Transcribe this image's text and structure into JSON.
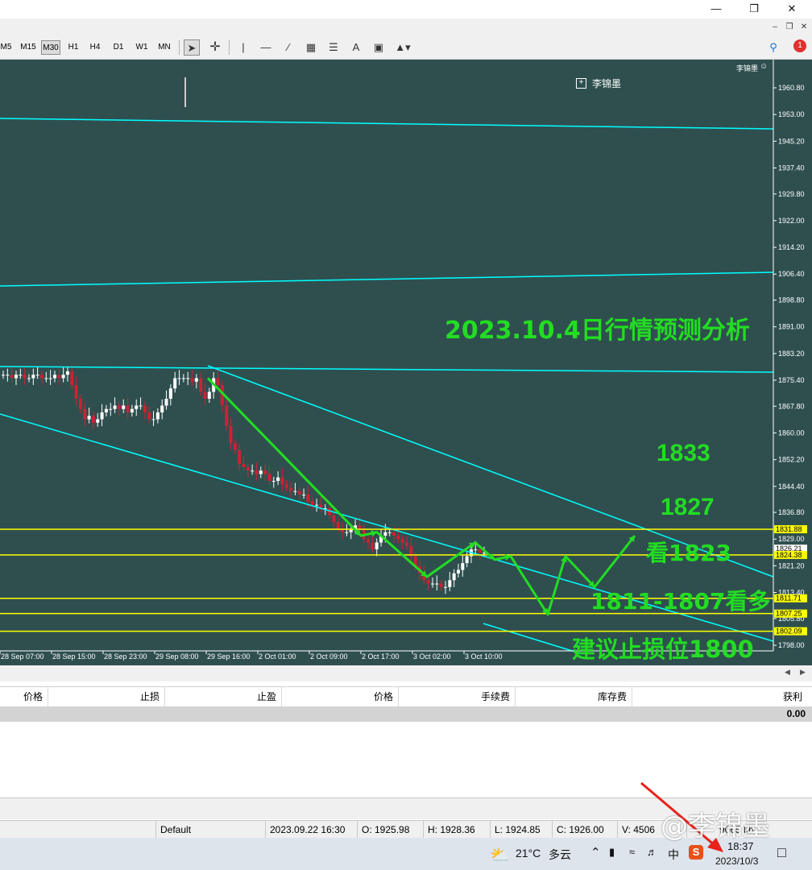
{
  "window": {
    "minimize_icon": "minimize-icon",
    "restore_icon": "restore-icon",
    "close_icon": "close-icon"
  },
  "toolbar": {
    "timeframes": [
      "M5",
      "M15",
      "M30",
      "H1",
      "H4",
      "D1",
      "W1",
      "MN"
    ],
    "active_timeframe": "M30",
    "tools": [
      "cursor-icon",
      "crosshair-icon",
      "vertical-line-icon",
      "horizontal-line-icon",
      "trendline-icon",
      "channel-icon",
      "fibonacci-icon",
      "text-icon",
      "text-label-icon",
      "shapes-icon"
    ],
    "search_icon": "search-icon",
    "notification_count": "1"
  },
  "chart": {
    "colors": {
      "background": "#2f4f4f",
      "line": "#00ffff",
      "level": "#ffff00",
      "arrow": "#22dd22",
      "annotation": "#22dd22",
      "bull": "#ffffff",
      "bear": "#cc2233",
      "axis_text": "#ffffff"
    },
    "top_right_label": "李锦墨",
    "object_label": "李锦墨",
    "annotation_title": "2023.10.4日行情预测分析",
    "annotations": [
      "1833",
      "1827",
      "看1823",
      "1811-1807看多",
      "建议止损位1800"
    ],
    "price_axis": [
      "1960.80",
      "1953.00",
      "1945.20",
      "1937.40",
      "1929.80",
      "1922.00",
      "1914.20",
      "1906.40",
      "1898.80",
      "1891.00",
      "1883.20",
      "1875.40",
      "1867.80",
      "1860.00",
      "1852.20",
      "1844.40",
      "1836.80",
      "1829.00",
      "1821.20",
      "1813.40",
      "1805.80",
      "1798.00"
    ],
    "price_labels": [
      "1831.88",
      "1826.21",
      "1824.38",
      "1811.71",
      "1807.25",
      "1802.09"
    ],
    "time_axis": [
      "28 Sep 07:00",
      "28 Sep 15:00",
      "28 Sep 23:00",
      "29 Sep 08:00",
      "29 Sep 16:00",
      "2 Oct 01:00",
      "2 Oct 09:00",
      "2 Oct 17:00",
      "3 Oct 02:00",
      "3 Oct 10:00"
    ]
  },
  "chart_data": {
    "type": "candlestick",
    "symbol_timeframe": "M30",
    "ylim": [
      1798.0,
      1964.0
    ],
    "x_ticks": [
      "28 Sep 07:00",
      "28 Sep 15:00",
      "28 Sep 23:00",
      "29 Sep 08:00",
      "29 Sep 16:00",
      "2 Oct 01:00",
      "2 Oct 09:00",
      "2 Oct 17:00",
      "3 Oct 02:00",
      "3 Oct 10:00"
    ],
    "y_ticks": [
      1960.8,
      1953.0,
      1945.2,
      1937.4,
      1929.8,
      1922.0,
      1914.2,
      1906.4,
      1898.8,
      1891.0,
      1883.2,
      1875.4,
      1867.8,
      1860.0,
      1852.2,
      1844.4,
      1836.8,
      1829.0,
      1821.2,
      1813.4,
      1805.8,
      1798.0
    ],
    "horizontal_levels": [
      1831.88,
      1824.38,
      1811.71,
      1807.25,
      1802.09
    ],
    "current_price": 1826.21,
    "close_series_approx": [
      1877,
      1877,
      1876,
      1877,
      1877,
      1876,
      1876,
      1877,
      1877,
      1876,
      1876,
      1876,
      1877,
      1876,
      1877,
      1878,
      1874,
      1870,
      1867,
      1864,
      1865,
      1863,
      1864,
      1866,
      1867,
      1867,
      1868,
      1867,
      1868,
      1866,
      1867,
      1868,
      1868,
      1866,
      1864,
      1864,
      1866,
      1868,
      1870,
      1873,
      1876,
      1876,
      1876,
      1876,
      1875,
      1876,
      1872,
      1870,
      1872,
      1876,
      1874,
      1868,
      1862,
      1857,
      1855,
      1851,
      1850,
      1849,
      1849,
      1848,
      1849,
      1848,
      1846,
      1846,
      1847,
      1845,
      1844,
      1843,
      1843,
      1842,
      1842,
      1840,
      1839,
      1839,
      1838,
      1838,
      1836,
      1834,
      1832,
      1831,
      1831,
      1832,
      1833,
      1832,
      1829,
      1828,
      1826,
      1828,
      1830,
      1831,
      1831,
      1830,
      1829,
      1828,
      1827,
      1824,
      1821,
      1819,
      1817,
      1816,
      1816,
      1816,
      1815,
      1815,
      1817,
      1819,
      1820,
      1822,
      1824,
      1826,
      1826,
      1825,
      1825
    ],
    "forecast_path": [
      1876,
      1830,
      1831,
      1818,
      1828,
      1823,
      1824,
      1807,
      1824,
      1815,
      1830
    ]
  },
  "terminal": {
    "columns": [
      "价格",
      "止损",
      "止盈",
      "价格",
      "手续费",
      "库存费",
      "获利"
    ],
    "total_profit": "0.00"
  },
  "statusbar": {
    "profile": "Default",
    "datetime": "2023.09.22 16:30",
    "open": "O: 1925.98",
    "high": "H: 1928.36",
    "low": "L: 1924.85",
    "close": "C: 1926.00",
    "volume": "V: 4506",
    "traffic": "9065 kb"
  },
  "taskbar": {
    "weather_icon": "cloud-sun-icon",
    "temperature": "21°C",
    "condition": "多云",
    "ime": "中",
    "time": "18:37",
    "date": "2023/10/3"
  },
  "watermark": "@李锦墨"
}
